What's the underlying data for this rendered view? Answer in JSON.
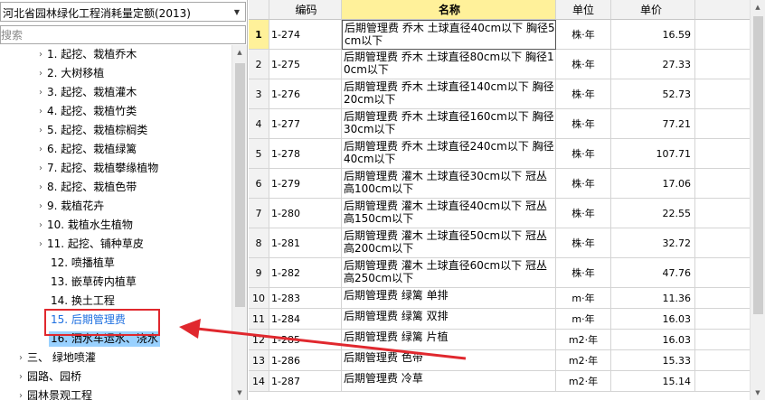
{
  "library": {
    "selected": "河北省园林绿化工程消耗量定额(2013)",
    "search_placeholder": "搜索"
  },
  "tree": [
    {
      "label": "1.  起挖、栽植乔木",
      "level": 2,
      "expander": true
    },
    {
      "label": "2.  大树移植",
      "level": 2,
      "expander": true
    },
    {
      "label": "3.  起挖、栽植灌木",
      "level": 2,
      "expander": true
    },
    {
      "label": "4.  起挖、栽植竹类",
      "level": 2,
      "expander": true
    },
    {
      "label": "5.  起挖、栽植棕榈类",
      "level": 2,
      "expander": true
    },
    {
      "label": "6.  起挖、栽植绿篱",
      "level": 2,
      "expander": true
    },
    {
      "label": "7.  起挖、栽植攀缘植物",
      "level": 2,
      "expander": true
    },
    {
      "label": "8.  起挖、栽植色带",
      "level": 2,
      "expander": true
    },
    {
      "label": "9.  栽植花卉",
      "level": 2,
      "expander": true
    },
    {
      "label": "10.  栽植水生植物",
      "level": 2,
      "expander": true
    },
    {
      "label": "11.  起挖、铺种草皮",
      "level": 2,
      "expander": true
    },
    {
      "label": "12.  喷播植草",
      "level": 2,
      "expander": false
    },
    {
      "label": "13.  嵌草砖内植草",
      "level": 2,
      "expander": false
    },
    {
      "label": "14.  换土工程",
      "level": 2,
      "expander": false
    },
    {
      "label": "15.  后期管理费",
      "level": 2,
      "expander": false,
      "state": "active"
    },
    {
      "label": "16.  洒水车运水、浇水",
      "level": 2,
      "expander": false,
      "state": "highlight"
    },
    {
      "label": "三、  绿地喷灌",
      "level": 1,
      "expander": true
    },
    {
      "label": "园路、园桥",
      "level": 0,
      "expander": true
    },
    {
      "label": "园林景观工程",
      "level": 0,
      "expander": true
    }
  ],
  "grid": {
    "columns": [
      "编码",
      "名称",
      "单位",
      "单价"
    ],
    "rows": [
      {
        "idx": "1",
        "code": "1-274",
        "name": "后期管理费  乔木  土球直径40cm以下  胸径5cm以下",
        "unit": "株·年",
        "price": "16.59"
      },
      {
        "idx": "2",
        "code": "1-275",
        "name": "后期管理费  乔木  土球直径80cm以下  胸径10cm以下",
        "unit": "株·年",
        "price": "27.33"
      },
      {
        "idx": "3",
        "code": "1-276",
        "name": "后期管理费  乔木  土球直径140cm以下  胸径20cm以下",
        "unit": "株·年",
        "price": "52.73"
      },
      {
        "idx": "4",
        "code": "1-277",
        "name": "后期管理费  乔木  土球直径160cm以下  胸径30cm以下",
        "unit": "株·年",
        "price": "77.21"
      },
      {
        "idx": "5",
        "code": "1-278",
        "name": "后期管理费  乔木  土球直径240cm以下  胸径40cm以下",
        "unit": "株·年",
        "price": "107.71"
      },
      {
        "idx": "6",
        "code": "1-279",
        "name": "后期管理费  灌木  土球直径30cm以下  冠丛高100cm以下",
        "unit": "株·年",
        "price": "17.06"
      },
      {
        "idx": "7",
        "code": "1-280",
        "name": "后期管理费  灌木  土球直径40cm以下  冠丛高150cm以下",
        "unit": "株·年",
        "price": "22.55"
      },
      {
        "idx": "8",
        "code": "1-281",
        "name": "后期管理费  灌木  土球直径50cm以下  冠丛高200cm以下",
        "unit": "株·年",
        "price": "32.72"
      },
      {
        "idx": "9",
        "code": "1-282",
        "name": "后期管理费  灌木  土球直径60cm以下  冠丛高250cm以下",
        "unit": "株·年",
        "price": "47.76"
      },
      {
        "idx": "10",
        "code": "1-283",
        "name": "后期管理费  绿篱  单排",
        "unit": "m·年",
        "price": "11.36"
      },
      {
        "idx": "11",
        "code": "1-284",
        "name": "后期管理费  绿篱  双排",
        "unit": "m·年",
        "price": "16.03"
      },
      {
        "idx": "12",
        "code": "1-285",
        "name": "后期管理费  绿篱  片植",
        "unit": "m2·年",
        "price": "16.03"
      },
      {
        "idx": "13",
        "code": "1-286",
        "name": "后期管理费  色带",
        "unit": "m2·年",
        "price": "15.33"
      },
      {
        "idx": "14",
        "code": "1-287",
        "name": "后期管理费  冷草",
        "unit": "m2·年",
        "price": "15.14"
      }
    ]
  },
  "icons": {
    "expander": "chevron-right-icon",
    "dropdown": "chevron-down-icon",
    "scroll_up": "triangle-up-icon",
    "scroll_down": "triangle-down-icon"
  },
  "colors": {
    "annotation": "#e0282e",
    "selection": "#99d1ff",
    "active_text": "#1e6fe0",
    "name_header": "#fff19a"
  }
}
